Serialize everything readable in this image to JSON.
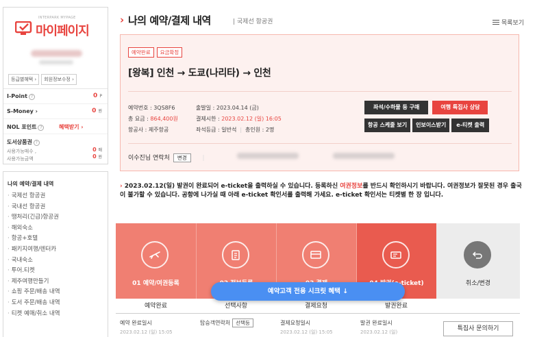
{
  "sidebar": {
    "brand_small": "INTERPARK MYPAGE",
    "brand_title": "마이페이지",
    "buttons": [
      "등급별혜택 ›",
      "회원정보수정 ›"
    ],
    "points": [
      {
        "label": "I-Point",
        "value": "0",
        "unit": "P"
      },
      {
        "label": "S-Money ›",
        "value": "0",
        "unit": "원"
      }
    ],
    "nol": {
      "label": "NOL 포인트",
      "link": "혜택받기 ›"
    },
    "gift": {
      "label": "도서상품권",
      "sub1": "사용가능매수 ,",
      "sub2": "사용가능금액",
      "v1": "0",
      "u1": "매",
      "v2": "0",
      "u2": "원"
    },
    "menu_title": "나의 예약/결제 내역",
    "menu": [
      "국제선 항공권",
      "국내선 항공권",
      "땡처리(긴급)항공권",
      "해외숙소",
      "항공+호텔",
      "패키지여행/렌터카",
      "국내숙소",
      "투어.티켓",
      "제주여행만들기",
      "쇼핑 주문/배송 내역",
      "도서 주문/배송 내역",
      "티켓 예매/취소 내역"
    ]
  },
  "header": {
    "title": "나의 예약/결제 내역",
    "subtitle": "| 국제선 항공권",
    "list_view": "목록보기"
  },
  "reservation": {
    "tags": [
      "예약완료",
      "요금확정"
    ],
    "route": "[왕복] 인천 → 도쿄(나리타) → 인천",
    "col1": {
      "line1": "예약번호 : 3QS8F6",
      "line2_label": "총 요금 : ",
      "line2_value": "864,400원",
      "line3": "항공사 : 제주항공"
    },
    "col2": {
      "line1": "출발일 : 2023.04.14 (금)",
      "line2_label": "결제시한 : ",
      "line2_value": "2023.02.12 (일) 16:05",
      "line3a": "좌석등급 : 일반석",
      "line3b": "총인원 : 2명"
    },
    "buttons_row1": [
      "좌석/수하물 등 구매",
      "여행 특집사 상담"
    ],
    "buttons_row2": [
      "항공 스케줄 보기",
      "인보이스받기",
      "e-티켓 출력"
    ],
    "contact_label": "이수진님 연락처",
    "contact_change": "변경"
  },
  "notice": {
    "part1": "2023.02.12(일) 발권이 완료되어 e-ticket을 출력하실 수 있습니다. 등록하신 ",
    "link": "여권정보",
    "part2": "를 반드시 확인하시기 바랍니다. 여권정보가 잘못된 경우 출국이 불가할 수 있습니다. 공항에 나가실 때 아래 e-ticket 확인서를 출력해 가세요. e-ticket 확인서는 티켓별 한 장 입니다."
  },
  "steps": [
    {
      "label": "01 예약/여권등록",
      "status": "예약완료"
    },
    {
      "label": "02 정보등록",
      "status": "선택사항"
    },
    {
      "label": "03 결제",
      "status": "결제요청"
    },
    {
      "label": "04 발권(e-ticket)",
      "status": "발권완료"
    },
    {
      "label": "취소/변경",
      "status": ""
    }
  ],
  "details": {
    "d1": "예약 완료일시",
    "d1b": "2023.02.12 (일) 15:05",
    "d2": "탑승객연락처",
    "d2btn": "선택등",
    "d3": "결제요청일시",
    "d3b": "2023.02.12 (일) 15:05",
    "d4": "발권 완료일시",
    "d4b": "2023.02.12 (일)",
    "consult": "특집사 문의하기"
  },
  "floating_banner": "예약고객 전용 시크릿 혜택 ↓",
  "colors": {
    "accent": "#e8443f",
    "step": "#f07f72",
    "banner": "#4a8ff2"
  }
}
